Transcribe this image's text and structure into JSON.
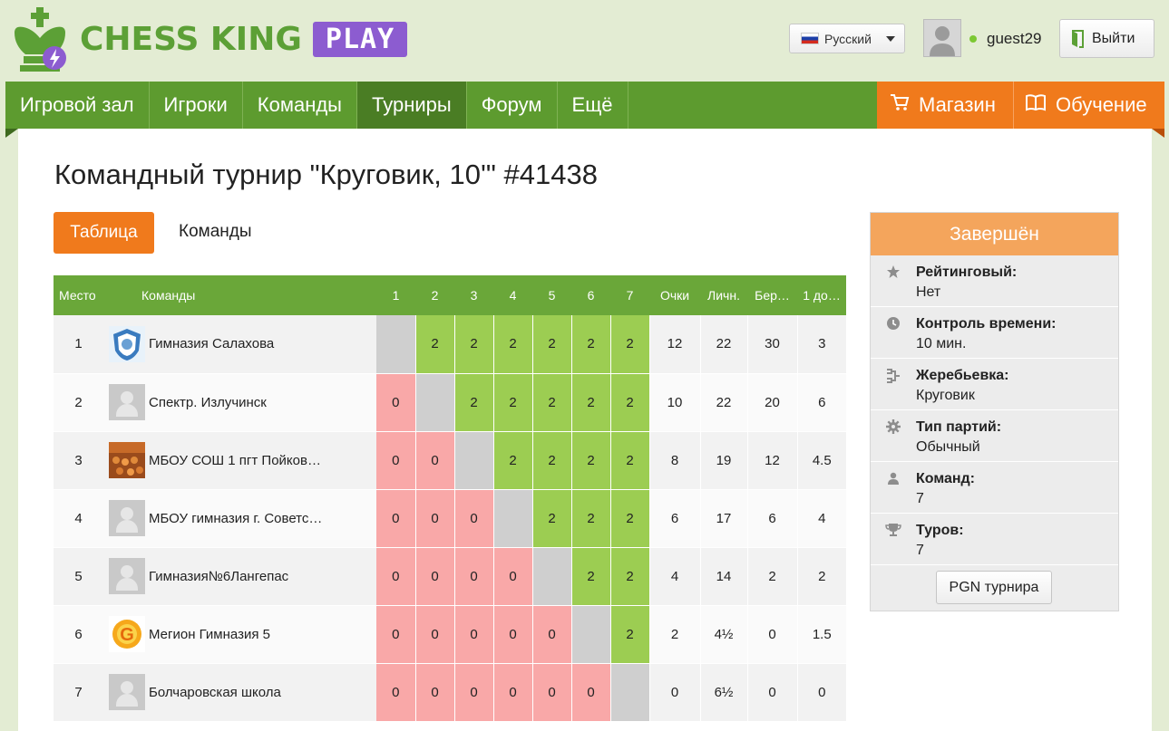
{
  "header": {
    "logo_text": "CHESS KING",
    "logo_play": "PLAY",
    "language": "Русский",
    "username": "guest29",
    "logout_label": "Выйти"
  },
  "nav": {
    "tabs": [
      "Игровой зал",
      "Игроки",
      "Команды",
      "Турниры",
      "Форум",
      "Ещё"
    ],
    "active_tab": "Турниры",
    "shop_label": "Магазин",
    "learn_label": "Обучение"
  },
  "page": {
    "title": "Командный турнир \"Круговик, 10'\" #41438",
    "tab_table": "Таблица",
    "tab_teams": "Команды"
  },
  "table": {
    "headers": {
      "place": "Место",
      "teams": "Команды",
      "rounds": [
        "1",
        "2",
        "3",
        "4",
        "5",
        "6",
        "7"
      ],
      "points": "Очки",
      "personal": "Личн.",
      "berger": "Бер…",
      "first": "1 до…"
    },
    "rows": [
      {
        "place": "1",
        "team": "Гимназия Салахова",
        "logo": "emblem",
        "results": [
          "",
          "2",
          "2",
          "2",
          "2",
          "2",
          "2"
        ],
        "points": "12",
        "personal": "22",
        "berger": "30",
        "first": "3"
      },
      {
        "place": "2",
        "team": "Спектр. Излучинск",
        "logo": "default",
        "results": [
          "0",
          "",
          "2",
          "2",
          "2",
          "2",
          "2"
        ],
        "points": "10",
        "personal": "22",
        "berger": "20",
        "first": "6"
      },
      {
        "place": "3",
        "team": "МБОУ СОШ 1 пгт Пойков…",
        "logo": "photo",
        "results": [
          "0",
          "0",
          "",
          "2",
          "2",
          "2",
          "2"
        ],
        "points": "8",
        "personal": "19",
        "berger": "12",
        "first": "4.5"
      },
      {
        "place": "4",
        "team": "МБОУ гимназия г. Советс…",
        "logo": "default",
        "results": [
          "0",
          "0",
          "0",
          "",
          "2",
          "2",
          "2"
        ],
        "points": "6",
        "personal": "17",
        "berger": "6",
        "first": "4"
      },
      {
        "place": "5",
        "team": "Гимназия№6Лангепас",
        "logo": "default",
        "results": [
          "0",
          "0",
          "0",
          "0",
          "",
          "2",
          "2"
        ],
        "points": "4",
        "personal": "14",
        "berger": "2",
        "first": "2"
      },
      {
        "place": "6",
        "team": "Мегион Гимназия 5",
        "logo": "sun",
        "results": [
          "0",
          "0",
          "0",
          "0",
          "0",
          "",
          "2"
        ],
        "points": "2",
        "personal": "4½",
        "berger": "0",
        "first": "1.5"
      },
      {
        "place": "7",
        "team": "Болчаровская школа",
        "logo": "default",
        "results": [
          "0",
          "0",
          "0",
          "0",
          "0",
          "0",
          ""
        ],
        "points": "0",
        "personal": "6½",
        "berger": "0",
        "first": "0"
      }
    ]
  },
  "side": {
    "status": "Завершён",
    "items": [
      {
        "icon": "star-icon",
        "key": "Рейтинговый:",
        "value": "Нет"
      },
      {
        "icon": "clock-icon",
        "key": "Контроль времени:",
        "value": "10 мин."
      },
      {
        "icon": "bracket-icon",
        "key": "Жеребьевка:",
        "value": "Круговик"
      },
      {
        "icon": "gear-icon",
        "key": "Тип партий:",
        "value": "Обычный"
      },
      {
        "icon": "person-icon",
        "key": "Команд:",
        "value": "7"
      },
      {
        "icon": "trophy-icon",
        "key": "Туров:",
        "value": "7"
      }
    ],
    "pgn_label": "PGN турнира"
  },
  "colors": {
    "nav_green": "#5d9b2f",
    "nav_active": "#4a7d24",
    "orange": "#f07a1c",
    "win": "#9ccd52",
    "lose": "#f9a8a8",
    "self": "#cfcfcf",
    "status_head": "#f4a55c",
    "logo_green": "#5ca036",
    "logo_purple": "#8c5cd0"
  }
}
